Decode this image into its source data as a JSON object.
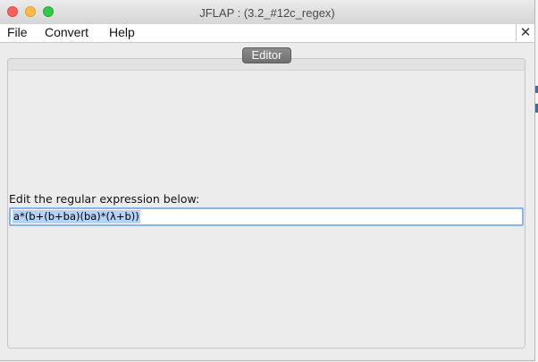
{
  "window": {
    "title": "JFLAP : (3.2_#12c_regex)"
  },
  "menubar": {
    "items": [
      "File",
      "Convert",
      "Help"
    ],
    "close_glyph": "✕"
  },
  "tab": {
    "label": "Editor"
  },
  "editor": {
    "prompt": "Edit the regular expression below:",
    "expression": "a*(b+(b+ba)(ba)*(λ+b))",
    "selection_color": "#b4d3f7",
    "focus_border_color": "#89b4e8"
  }
}
